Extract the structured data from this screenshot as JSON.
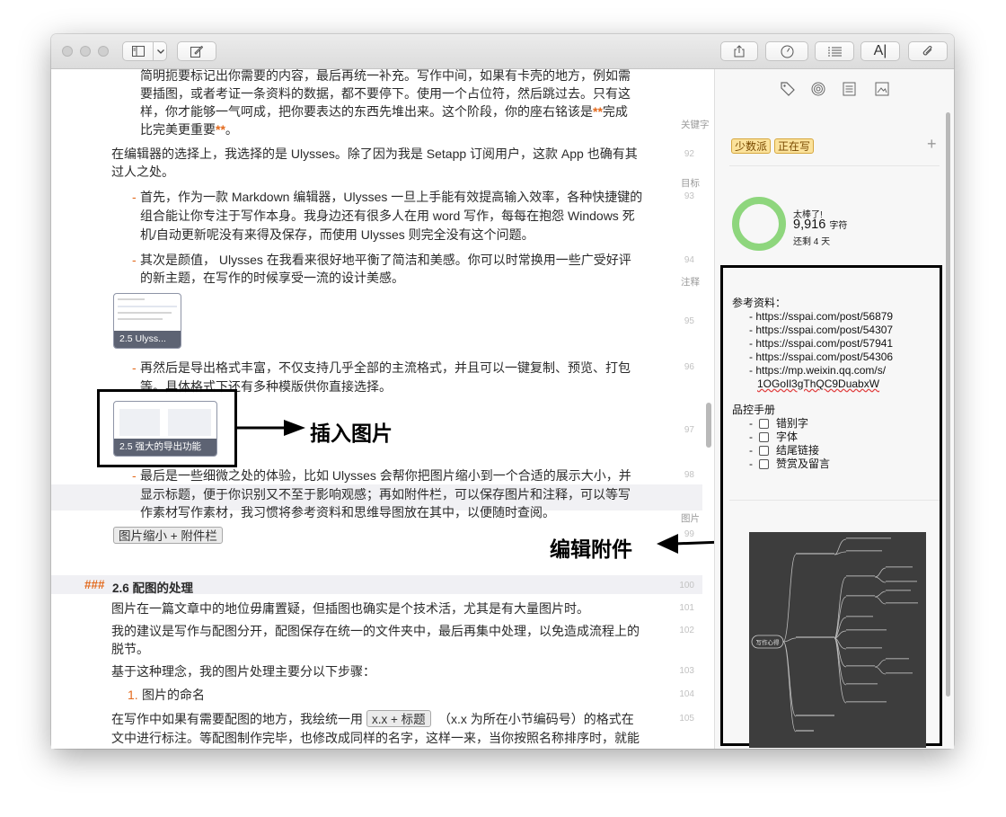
{
  "toolbar": {
    "sidebar_toggle_icon": "sidebar-icon",
    "compose_icon": "compose-icon",
    "right_icons": [
      "share-icon",
      "dashboard-icon",
      "list-icon",
      "text-format-icon",
      "attachment-icon"
    ]
  },
  "editor": {
    "lines": [
      {
        "text": "简明扼要标记出你需要的内容，最后再统一补充。写作中间，如果有卡壳的地方，例如需"
      },
      {
        "text": "要插图，或者考证一条资料的数据，都不要停下。使用一个占位符，然后跳过去。只有这"
      },
      {
        "text": "样，你才能够一气呵成，把你要表达的东西先堆出来。这个阶段，你的座右铭该是"
      },
      {
        "text": "比完美更重要"
      },
      {
        "text": "在编辑器的选择上，我选择的是 Ulysses。除了因为我是 Setapp 订阅用户，这款 App 也确有其"
      },
      {
        "text": "过人之处。"
      },
      {
        "text": "首先，作为一款 Markdown 编辑器，Ulysses 一旦上手能有效提高输入效率，各种快捷键的"
      },
      {
        "text": "组合能让你专注于写作本身。我身边还有很多人在用 word 写作，每每在抱怨 Windows 死"
      },
      {
        "text": "机/自动更新呢没有来得及保存，而使用 Ulysses 则完全没有这个问题。"
      },
      {
        "text": "其次是颜值， Ulysses 在我看来很好地平衡了简洁和美感。你可以时常换用一些广受好评"
      },
      {
        "text": "的新主题，在写作的时候享受一流的设计美感。"
      },
      {
        "text": "再然后是导出格式丰富，不仅支持几乎全部的主流格式，并且可以一键复制、预览、打包"
      },
      {
        "text": "等。具体格式下还有多种模版供你直接选择。"
      },
      {
        "text": "最后是一些细微之处的体验，比如 Ulysses 会帮你把图片缩小到一个合适的展示大小，并"
      },
      {
        "text": "显示标题，便于你识别又不至于影响观感；再如附件栏，可以保存图片和注释，可以等写"
      },
      {
        "text": "作素材写作素材，我习惯将参考资料和思维导图放在其中，以便随时查阅。"
      },
      {
        "text": "图片在一篇文章中的地位毋庸置疑，但插图也确实是个技术活，尤其是有大量图片时。"
      },
      {
        "text": "我的建议是写作与配图分开，配图保存在统一的文件夹中，最后再集中处理，以免造成流程上的"
      },
      {
        "text": "脱节。"
      },
      {
        "text": "基于这种理念，我的图片处理主要分以下步骤："
      },
      {
        "text": "图片的命名"
      },
      {
        "text": "在写作中如果有需要配图的地方，我绘统一用"
      },
      {
        "text": "（x.x 为所在小节编码号）的格式在"
      },
      {
        "text": "文中进行标注。等配图制作完毕，也修改成同样的名字，这样一来，当你按照名称排序时，就能"
      }
    ],
    "bold_marker_open": "**",
    "bold_text": "完成",
    "bold_marker_close": "**",
    "period": "。",
    "bullet": "-",
    "numbered_prefix": "1.",
    "line_numbers": [
      "92",
      "93",
      "94",
      "95",
      "96",
      "97",
      "98",
      "99",
      "100",
      "101",
      "102",
      "103",
      "104",
      "105"
    ],
    "image_captions": [
      "2.5 Ulyss...",
      "2.5 强大的导出功能"
    ],
    "tags": [
      "图片缩小 + 附件栏",
      "x.x + 标题"
    ],
    "heading_marker": "###",
    "heading_text": "2.6 配图的处理"
  },
  "annotations": {
    "insert_image": "插入图片",
    "edit_attachment": "编辑附件"
  },
  "sidebar": {
    "tab_icons": [
      "tag-icon",
      "target-icon",
      "notes-icon",
      "image-icon"
    ],
    "keywords_label": "关键字",
    "keywords": [
      "少数派",
      "正在写"
    ],
    "add_keyword": "+",
    "goal_label": "目标",
    "goal_message": "太棒了!",
    "goal_count": "9,916",
    "goal_unit": "字符",
    "goal_remaining": "还剩 4 天",
    "goal_progress": 1.0,
    "notes_label": "注释",
    "notes_title": "参考资料：",
    "links": [
      "- https://sspai.com/post/56879",
      "- https://sspai.com/post/54307",
      "- https://sspai.com/post/57941",
      "- https://sspai.com/post/54306",
      "- https://mp.weixin.qq.com/s/"
    ],
    "link_tail": "1OGoIl3gThQC9DuabxW",
    "checklist_title": "品控手册",
    "checklist": [
      "错别字",
      "字体",
      "结尾链接",
      "赞赏及留言"
    ],
    "images_label": "图片",
    "mindmap_center": "写作心得"
  },
  "colors": {
    "accent": "#e36a1d",
    "goal_ring": "#8ed67d",
    "keyword_bg": "#fbe29b"
  }
}
